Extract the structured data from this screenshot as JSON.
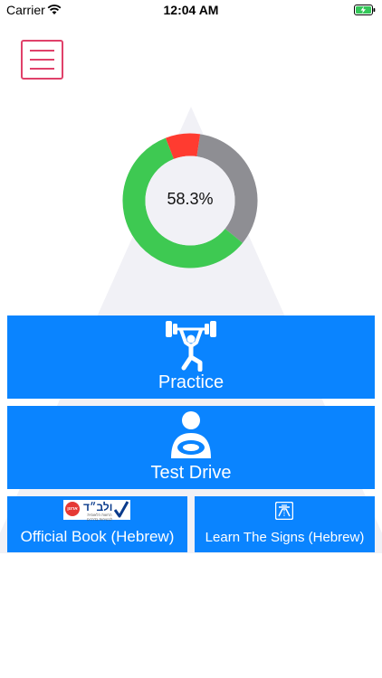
{
  "status_bar": {
    "carrier": "Carrier",
    "time": "12:04 AM"
  },
  "progress": {
    "label": "58.3%",
    "correct_fraction": 0.583,
    "wrong_fraction": 0.083,
    "unanswered_fraction": 0.334,
    "colors": {
      "correct": "#3ec952",
      "wrong": "#ff3b30",
      "unanswered": "#8e8e93"
    }
  },
  "buttons": {
    "practice": "Practice",
    "test_drive": "Test Drive",
    "official_book": "Official Book (Hebrew)",
    "learn_signs": "Learn The Signs (Hebrew)"
  },
  "book_logo": {
    "word": "ולב״ד",
    "seal": "ארגון",
    "sub": "הרשות הלאומית לבטיחות בדרכים"
  },
  "icons": {
    "menu": "hamburger-icon",
    "practice": "weightlifter-icon",
    "test_drive": "driver-steering-wheel-icon",
    "learn_signs": "highway-sign-icon"
  },
  "colors": {
    "accent_blue": "#0a84ff",
    "menu_red": "#e0416a",
    "pyramid": "#f2f2f7"
  }
}
